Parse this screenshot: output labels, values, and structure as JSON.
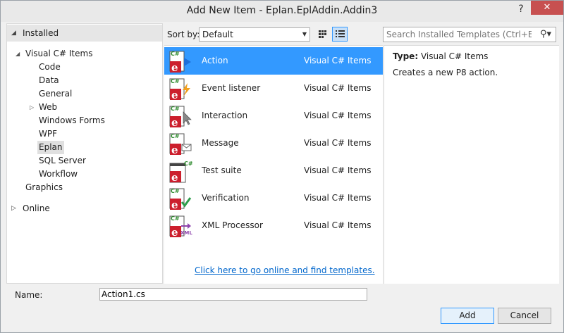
{
  "window": {
    "title": "Add New Item - Eplan.EplAddin.Addin3",
    "help_label": "?",
    "close_label": "✕"
  },
  "left_pane": {
    "installed_label": "Installed",
    "online_label": "Online",
    "tree": {
      "root": "Visual C# Items",
      "children": [
        "Code",
        "Data",
        "General",
        "Web",
        "Windows Forms",
        "WPF",
        "Eplan",
        "SQL Server",
        "Workflow"
      ],
      "graphics": "Graphics"
    }
  },
  "toolbar": {
    "sort_label": "Sort by:",
    "sort_value": "Default",
    "search_placeholder": "Search Installed Templates (Ctrl+E)"
  },
  "templates": [
    {
      "name": "Action",
      "category": "Visual C# Items",
      "icon": "action-icon"
    },
    {
      "name": "Event listener",
      "category": "Visual C# Items",
      "icon": "event-icon"
    },
    {
      "name": "Interaction",
      "category": "Visual C# Items",
      "icon": "interaction-icon"
    },
    {
      "name": "Message",
      "category": "Visual C# Items",
      "icon": "message-icon"
    },
    {
      "name": "Test suite",
      "category": "Visual C# Items",
      "icon": "test-suite-icon"
    },
    {
      "name": "Verification",
      "category": "Visual C# Items",
      "icon": "verification-icon"
    },
    {
      "name": "XML Processor",
      "category": "Visual C# Items",
      "icon": "xml-icon"
    }
  ],
  "online_link": "Click here to go online and find templates.",
  "details": {
    "type_label": "Type:",
    "type_value": "Visual C# Items",
    "description": "Creates a new P8 action."
  },
  "footer": {
    "name_label": "Name:",
    "name_value": "Action1.cs",
    "add_label": "Add",
    "cancel_label": "Cancel"
  },
  "colors": {
    "selection": "#3399ff",
    "eplan_red": "#cc1f2d",
    "csharp_green": "#2e8b2e",
    "link": "#0066cc"
  }
}
